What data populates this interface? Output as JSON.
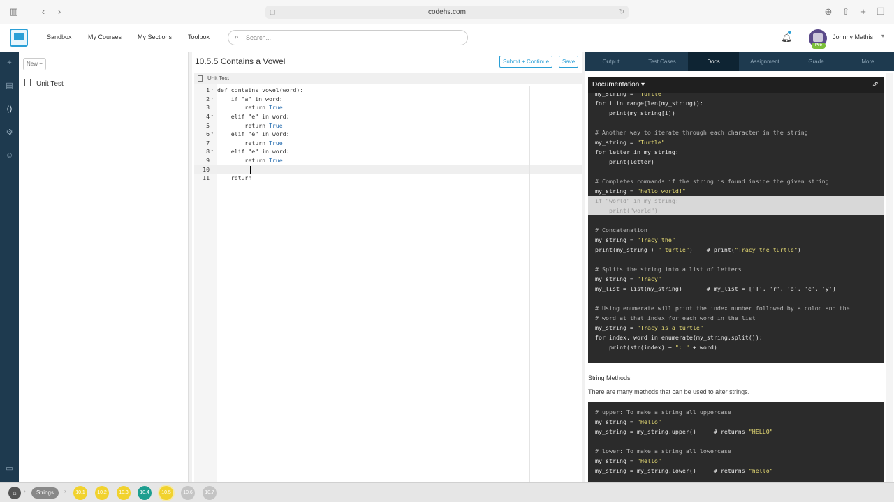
{
  "browser": {
    "url": "codehs.com",
    "icons": [
      "sidebar-icon",
      "back-icon",
      "forward-icon",
      "lock-icon",
      "reload-icon",
      "download-icon",
      "share-icon",
      "new-tab-icon",
      "tabs-icon"
    ]
  },
  "nav": {
    "links": [
      "Sandbox",
      "My Courses",
      "My Sections",
      "Toolbox"
    ],
    "search_placeholder": "Search...",
    "user_name": "Johnny Mathis",
    "badge": "Pro"
  },
  "files": {
    "new_label": "New +",
    "items": [
      "Unit Test"
    ]
  },
  "editor": {
    "title": "10.5.5 Contains a Vowel",
    "submit_label": "Submit + Continue",
    "save_label": "Save",
    "tab_label": "Unit Test",
    "lines": [
      {
        "n": "1",
        "t": "def contains_vowel(word):",
        "fold": true
      },
      {
        "n": "2",
        "t": "    if \"a\" in word:",
        "fold": true
      },
      {
        "n": "3",
        "t": "        return True",
        "fold": false
      },
      {
        "n": "4",
        "t": "    elif \"e\" in word:",
        "fold": true
      },
      {
        "n": "5",
        "t": "        return True",
        "fold": false
      },
      {
        "n": "6",
        "t": "    elif \"e\" in word:",
        "fold": true
      },
      {
        "n": "7",
        "t": "        return True",
        "fold": false
      },
      {
        "n": "8",
        "t": "    elif \"e\" in word:",
        "fold": true
      },
      {
        "n": "9",
        "t": "        return True",
        "fold": false
      },
      {
        "n": "10",
        "t": "        ",
        "fold": false
      },
      {
        "n": "11",
        "t": "    return",
        "fold": false
      }
    ]
  },
  "right_tabs": [
    "Output",
    "Test Cases",
    "Docs",
    "Assignment",
    "Grade",
    "More"
  ],
  "active_right_tab": "Docs",
  "docs": {
    "header": "Documentation",
    "block1": [
      "my_string = \"Turtle\"",
      "for i in range(len(my_string)):",
      "    print(my_string[i])",
      "",
      "# Another way to iterate through each character in the string",
      "my_string = \"Turtle\"",
      "for letter in my_string:",
      "    print(letter)",
      "",
      "# Completes commands if the string is found inside the given string",
      "my_string = \"hello world!\"",
      "if \"world\" in my_string:",
      "    print(\"world\")",
      "",
      "# Concatenation",
      "my_string = \"Tracy the\"",
      "print(my_string + \" turtle\")    # print(\"Tracy the turtle\")",
      "",
      "# Splits the string into a list of letters",
      "my_string = \"Tracy\"",
      "my_list = list(my_string)       # my_list = ['T', 'r', 'a', 'c', 'y']",
      "",
      "# Using enumerate will print the index number followed by a colon and the",
      "# word at that index for each word in the list",
      "my_string = \"Tracy is a turtle\"",
      "for index, word in enumerate(my_string.split()):",
      "    print(str(index) + \": \" + word)"
    ],
    "section_title": "String Methods",
    "section_desc": "There are many methods that can be used to alter strings.",
    "block2": [
      "# upper: To make a string all uppercase",
      "my_string = \"Hello\"",
      "my_string = my_string.upper()     # returns \"HELLO\"",
      "",
      "# lower: To make a string all lowercase",
      "my_string = \"Hello\"",
      "my_string = my_string.lower()     # returns \"hello\""
    ]
  },
  "bottom": {
    "crumb": "Strings",
    "lessons": [
      "10.1",
      "10.2",
      "10.3",
      "10.4",
      "10.5",
      "10.6",
      "10.7"
    ]
  }
}
